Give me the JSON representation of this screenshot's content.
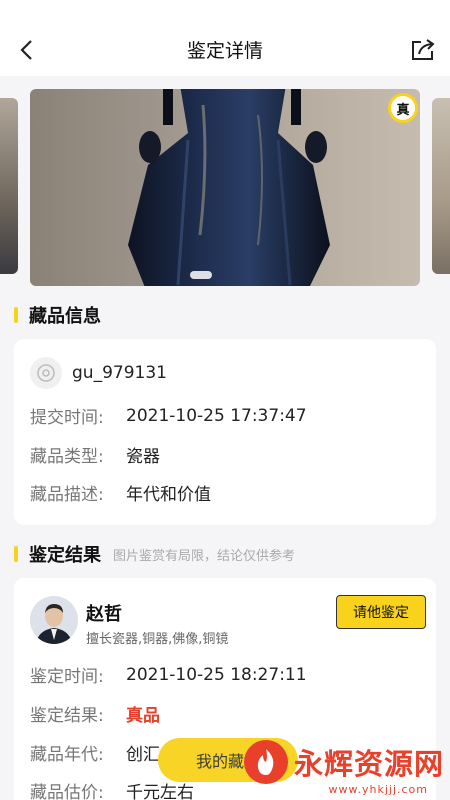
{
  "header": {
    "title": "鉴定详情",
    "back_icon": "chevron-left-icon",
    "share_icon": "share-icon"
  },
  "carousel": {
    "badge": "真",
    "active_index": 1
  },
  "collection": {
    "section_title": "藏品信息",
    "username": "gu_979131",
    "rows": [
      {
        "label": "提交时间:",
        "value": "2021-10-25 17:37:47"
      },
      {
        "label": "藏品类型:",
        "value": "瓷器"
      },
      {
        "label": "藏品描述:",
        "value": "年代和价值"
      }
    ]
  },
  "result": {
    "section_title": "鉴定结果",
    "note": "图片鉴赏有局限，结论仅供参考",
    "expert": {
      "name": "赵哲",
      "skill": "擅长瓷器,铜器,佛像,铜镜",
      "button": "请他鉴定"
    },
    "rows": [
      {
        "label": "鉴定时间:",
        "value": "2021-10-25 18:27:11"
      },
      {
        "label": "鉴定结果:",
        "value": "真品"
      },
      {
        "label": "藏品年代:",
        "value": "创汇"
      },
      {
        "label": "藏品估价:",
        "value": "千元左右"
      }
    ]
  },
  "floating_button": "我的藏品",
  "watermark": {
    "text": "永辉资源网",
    "url": "www.yhkjjj.com"
  },
  "colors": {
    "accent": "#f8d21b",
    "highlight": "#e8402b"
  }
}
